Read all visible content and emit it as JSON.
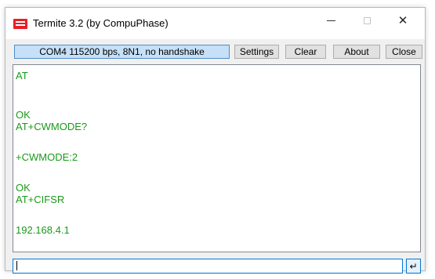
{
  "window": {
    "title": "Termite 3.2 (by CompuPhase)",
    "controls": {
      "minimize": "–",
      "maximize": "□",
      "close": "✕"
    }
  },
  "toolbar": {
    "status": "COM4 115200 bps, 8N1, no handshake",
    "settings_label": "Settings",
    "clear_label": "Clear",
    "about_label": "About",
    "close_label": "Close"
  },
  "terminal": {
    "lines": [
      "AT",
      "OK",
      "AT+CWMODE?",
      "+CWMODE:2",
      "OK",
      "AT+CIFSR",
      "192.168.4.1"
    ],
    "text_color": "#1a9a1a"
  },
  "input": {
    "value": "",
    "send_icon": "enter-arrow-icon",
    "send_glyph": "↵"
  },
  "colors": {
    "status_bg": "#c6e0f7",
    "status_border": "#4d8ec9",
    "app_icon": "#e81f27"
  }
}
